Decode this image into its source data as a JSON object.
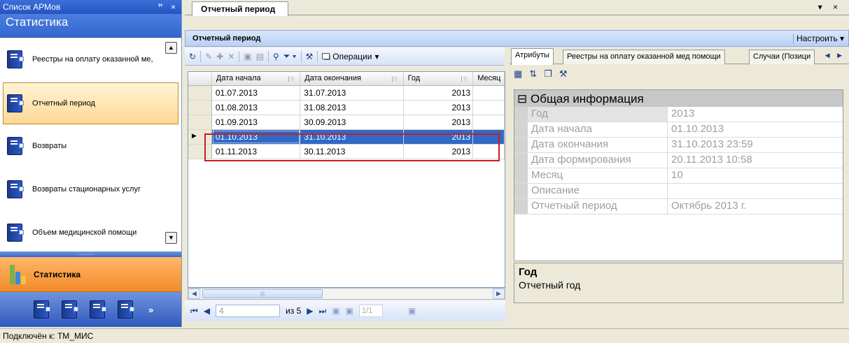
{
  "left_panel": {
    "caption": "Список АРМов",
    "caption_controls": "ꟸ ×",
    "title": "Статистика",
    "items": [
      {
        "label": "Реестры на оплату оказанной ме,"
      },
      {
        "label": "Отчетный период"
      },
      {
        "label": "Возвраты"
      },
      {
        "label": "Возвраты стационарных услуг"
      },
      {
        "label": "Объем медицинской помощи"
      }
    ],
    "splitter_grip": "........",
    "group_label": "Статистика",
    "more_symbol": "»"
  },
  "document": {
    "tab_label": "Отчетный период",
    "controls": "▾ ×",
    "header_title": "Отчетный период",
    "configure_label": "Настроить ▾"
  },
  "toolbar": {
    "operations_label": "Операции"
  },
  "grid": {
    "columns": [
      "Дата начала",
      "Дата окончания",
      "Год",
      "Месяц"
    ],
    "rows": [
      {
        "start": "01.07.2013",
        "end": "31.07.2013",
        "year": "2013",
        "selected": false
      },
      {
        "start": "01.08.2013",
        "end": "31.08.2013",
        "year": "2013",
        "selected": false
      },
      {
        "start": "01.09.2013",
        "end": "30.09.2013",
        "year": "2013",
        "selected": false
      },
      {
        "start": "01.10.2013",
        "end": "31.10.2013",
        "year": "2013",
        "selected": true
      },
      {
        "start": "01.11.2013",
        "end": "30.11.2013",
        "year": "2013",
        "selected": false
      }
    ]
  },
  "navigator": {
    "current": "4",
    "of_label": "из 5",
    "page": "1/1"
  },
  "properties": {
    "tabs": [
      "Атрибуты",
      "Реестры на оплату оказанной мед помощи",
      "Случаи (Позици"
    ],
    "category": "Общая информация",
    "rows": [
      {
        "key": "Год",
        "value": "2013"
      },
      {
        "key": "Дата начала",
        "value": "01.10.2013"
      },
      {
        "key": "Дата окончания",
        "value": "31.10.2013 23:59"
      },
      {
        "key": "Дата формирования",
        "value": "20.11.2013 10:58"
      },
      {
        "key": "Месяц",
        "value": "10"
      },
      {
        "key": "Описание",
        "value": ""
      },
      {
        "key": "Отчетный период",
        "value": "Октябрь 2013 г."
      }
    ],
    "desc_title": "Год",
    "desc_text": "Отчетный год"
  },
  "status": {
    "text": "Подключён к: ТМ_МИС"
  }
}
